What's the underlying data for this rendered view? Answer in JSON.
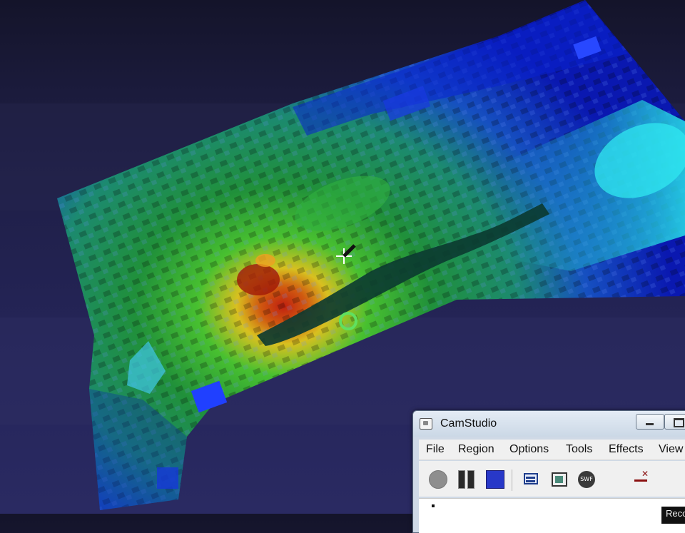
{
  "window": {
    "title": "CamStudio"
  },
  "menu": [
    "File",
    "Region",
    "Options",
    "Tools",
    "Effects",
    "View"
  ],
  "toolbar": {
    "icons": [
      "record-icon",
      "pause-icon",
      "stop-icon",
      "picture-in-picture-icon",
      "video-file-icon",
      "swf-icon",
      "autopan-icon"
    ]
  },
  "status": {
    "tooltip_fragment": "Reco"
  },
  "scene": {
    "palette": [
      "#1028d8",
      "#18a0c8",
      "#20c8c8",
      "#38c040",
      "#e0c020",
      "#c02010"
    ]
  }
}
